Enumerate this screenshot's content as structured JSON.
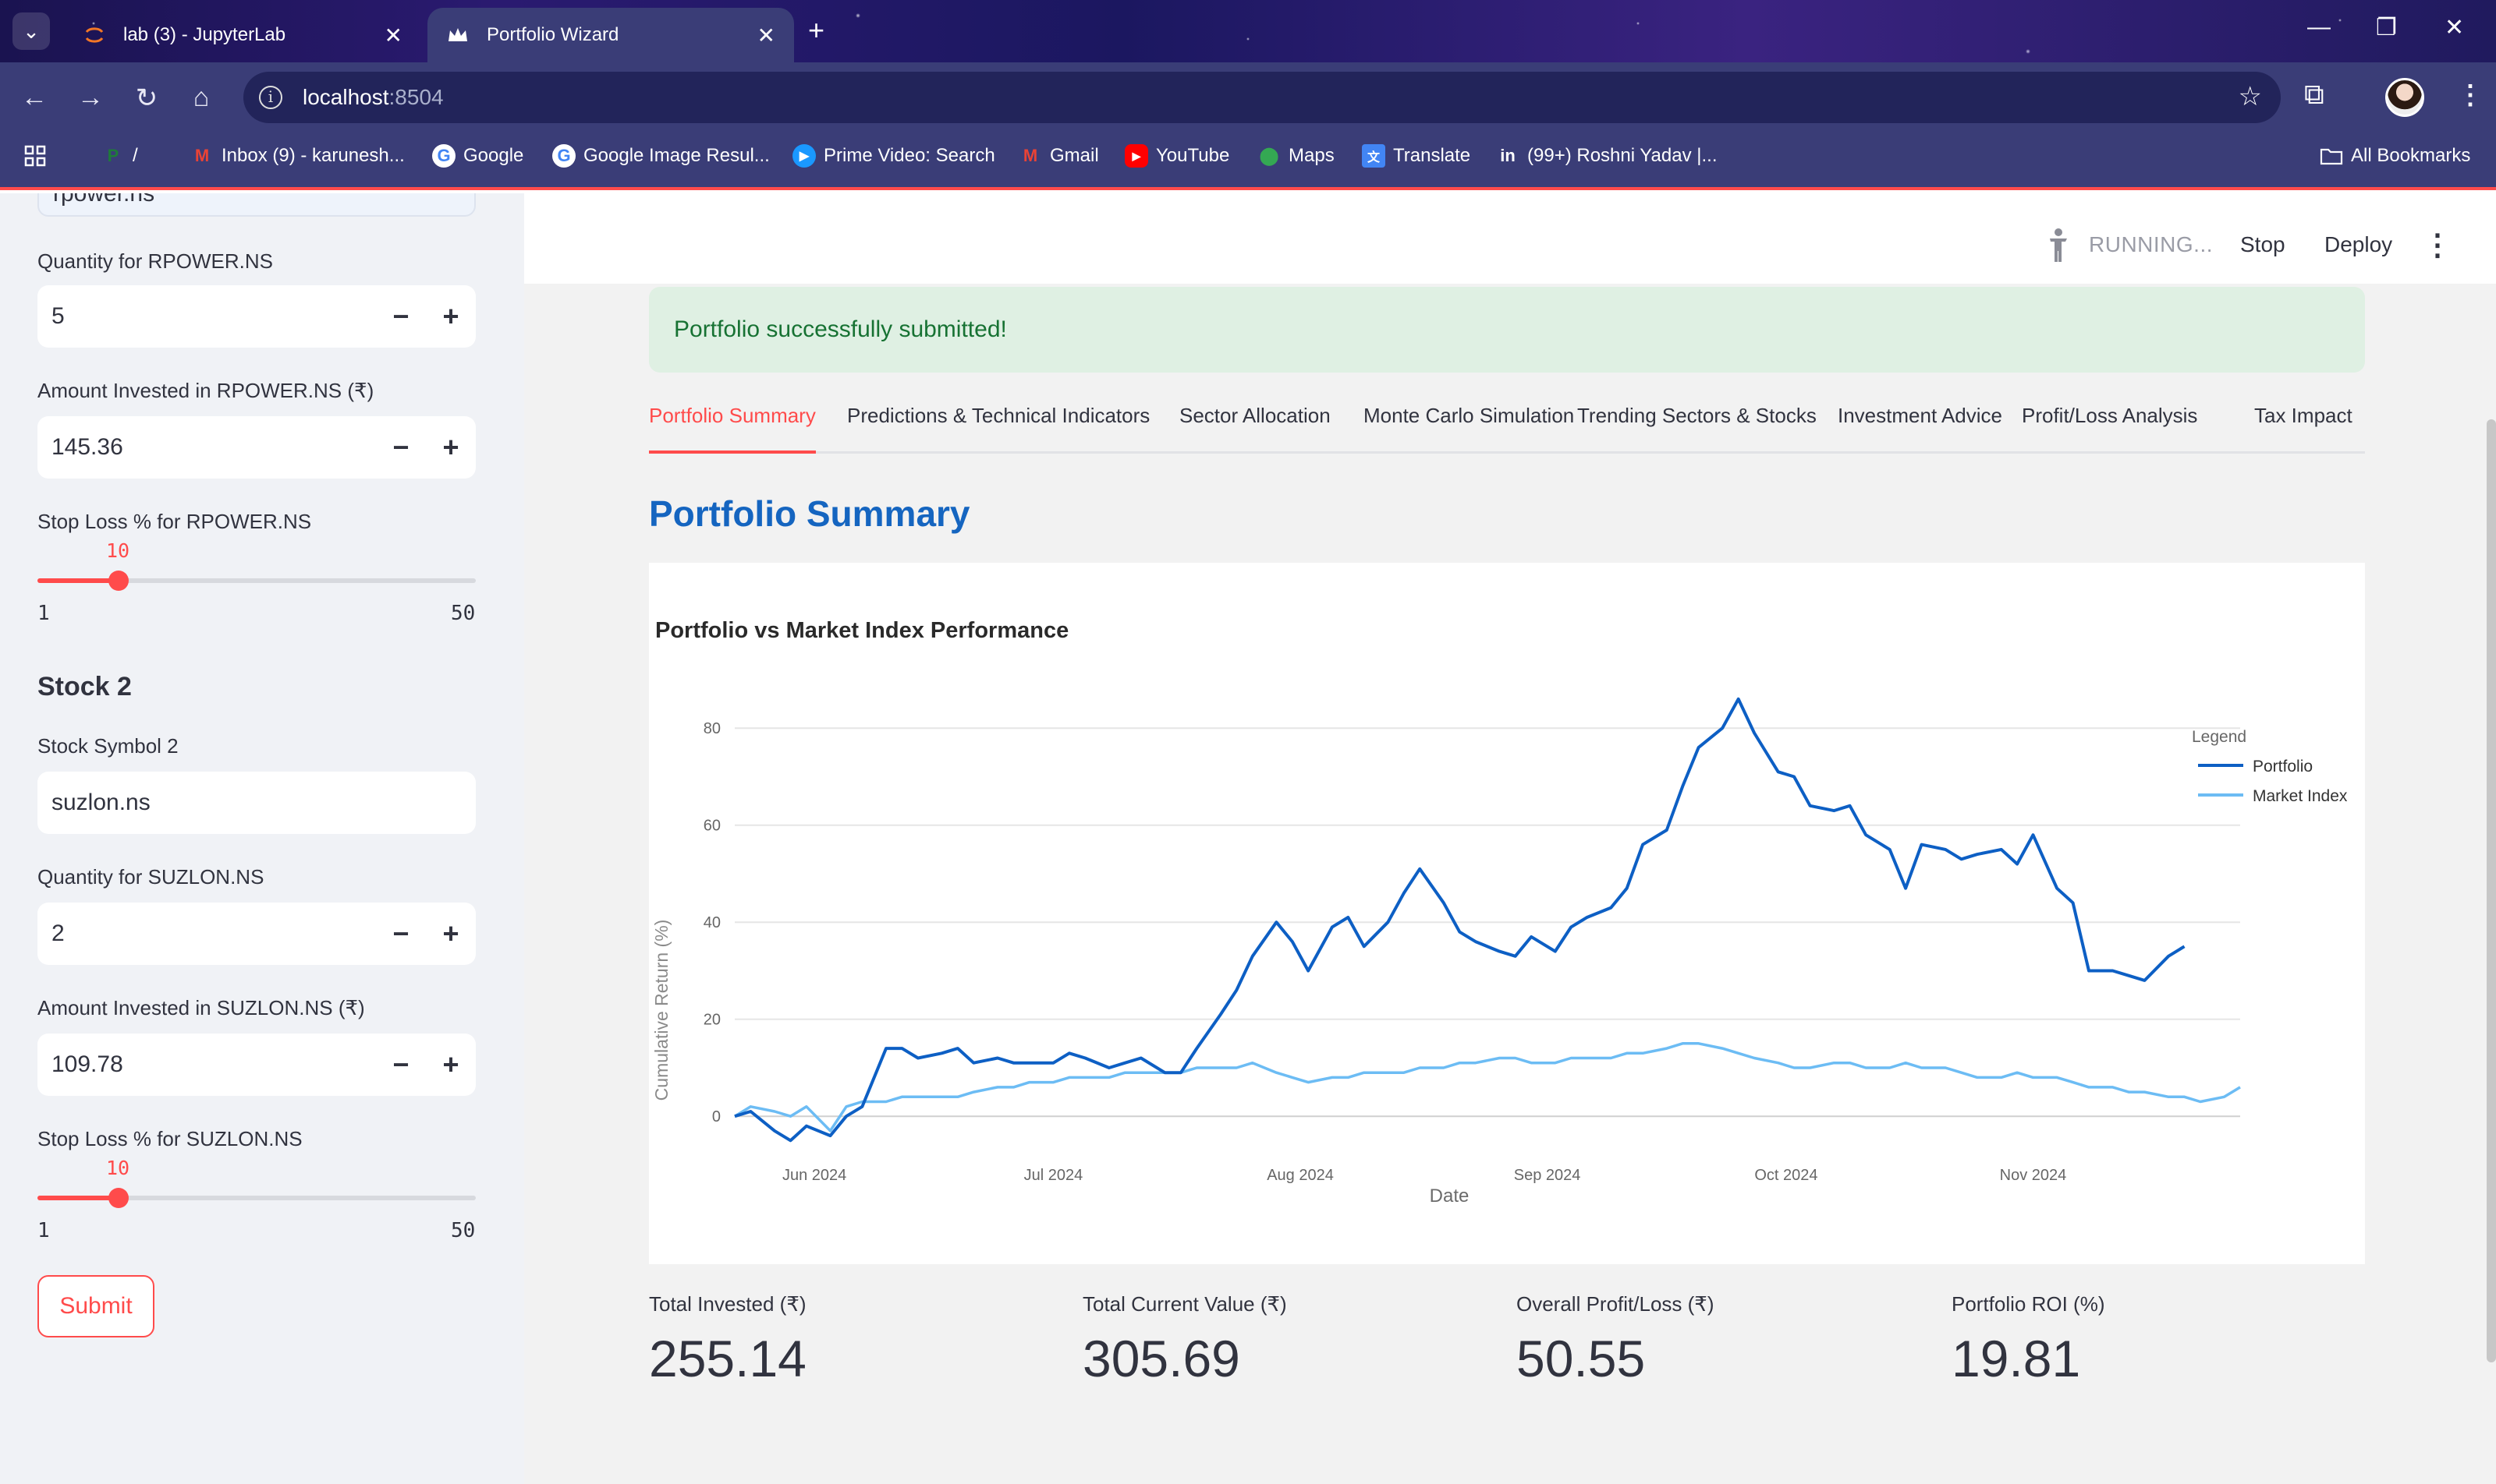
{
  "browser": {
    "tabs": [
      {
        "title": "lab (3) - JupyterLab",
        "active": false
      },
      {
        "title": "Portfolio Wizard",
        "active": true
      }
    ],
    "url_host": "localhost",
    "url_port": ":8504",
    "bookmarks": [
      {
        "label": "/",
        "icon": "separator-slash-icon"
      },
      {
        "label": "Inbox (9) - karunesh...",
        "icon": "gmail-icon"
      },
      {
        "label": "Google",
        "icon": "google-icon"
      },
      {
        "label": "Google Image Resul...",
        "icon": "google-icon"
      },
      {
        "label": "Prime Video: Search",
        "icon": "prime-video-icon"
      },
      {
        "label": "Gmail",
        "icon": "gmail-icon"
      },
      {
        "label": "YouTube",
        "icon": "youtube-icon"
      },
      {
        "label": "Maps",
        "icon": "maps-icon"
      },
      {
        "label": "Translate",
        "icon": "translate-icon"
      },
      {
        "label": "(99+) Roshni Yadav |...",
        "icon": "linkedin-icon"
      }
    ],
    "all_bookmarks": "All Bookmarks"
  },
  "sidebar": {
    "partial_value": "rpower.ns",
    "stock1": {
      "quantity_label": "Quantity for RPOWER.NS",
      "quantity_value": "5",
      "amount_label": "Amount Invested in RPOWER.NS (₹)",
      "amount_value": "145.36",
      "stoploss_label": "Stop Loss % for RPOWER.NS",
      "stoploss_value": "10",
      "stoploss_min": "1",
      "stoploss_max": "50"
    },
    "stock2": {
      "heading": "Stock 2",
      "symbol_label": "Stock Symbol 2",
      "symbol_value": "suzlon.ns",
      "quantity_label": "Quantity for SUZLON.NS",
      "quantity_value": "2",
      "amount_label": "Amount Invested in SUZLON.NS (₹)",
      "amount_value": "109.78",
      "stoploss_label": "Stop Loss % for SUZLON.NS",
      "stoploss_value": "10",
      "stoploss_min": "1",
      "stoploss_max": "50"
    },
    "submit_label": "Submit",
    "stepper_minus": "−",
    "stepper_plus": "+"
  },
  "header": {
    "status": "RUNNING...",
    "stop_label": "Stop",
    "deploy_label": "Deploy"
  },
  "main": {
    "success_message": "Portfolio successfully submitted!",
    "tabs": [
      {
        "label": "Portfolio Summary",
        "active": true
      },
      {
        "label": "Predictions & Technical Indicators"
      },
      {
        "label": "Sector Allocation"
      },
      {
        "label": "Monte Carlo Simulation"
      },
      {
        "label": "Trending Sectors & Stocks"
      },
      {
        "label": "Investment Advice"
      },
      {
        "label": "Profit/Loss Analysis"
      },
      {
        "label": "Tax Impact"
      }
    ],
    "section_title": "Portfolio Summary",
    "metrics": [
      {
        "label": "Total Invested (₹)",
        "value": "255.14"
      },
      {
        "label": "Total Current Value (₹)",
        "value": "305.69"
      },
      {
        "label": "Overall Profit/Loss (₹)",
        "value": "50.55"
      },
      {
        "label": "Portfolio ROI (%)",
        "value": "19.81"
      }
    ]
  },
  "chart_data": {
    "type": "line",
    "title": "Portfolio vs Market Index Performance",
    "xlabel": "Date",
    "ylabel": "Cumulative Return (%)",
    "x_tick_labels": [
      "Jun 2024",
      "Jul 2024",
      "Aug 2024",
      "Sep 2024",
      "Oct 2024",
      "Nov 2024"
    ],
    "y_ticks": [
      0,
      20,
      40,
      60,
      80
    ],
    "xlim": [
      "2024-05-22",
      "2024-11-27"
    ],
    "ylim": [
      -8,
      90
    ],
    "grid": true,
    "legend_title": "Legend",
    "legend_position": "top-right",
    "x": [
      "2024-05-22",
      "2024-05-24",
      "2024-05-27",
      "2024-05-29",
      "2024-05-31",
      "2024-06-03",
      "2024-06-05",
      "2024-06-07",
      "2024-06-10",
      "2024-06-12",
      "2024-06-14",
      "2024-06-17",
      "2024-06-19",
      "2024-06-21",
      "2024-06-24",
      "2024-06-26",
      "2024-06-28",
      "2024-07-01",
      "2024-07-03",
      "2024-07-05",
      "2024-07-08",
      "2024-07-10",
      "2024-07-12",
      "2024-07-15",
      "2024-07-17",
      "2024-07-19",
      "2024-07-22",
      "2024-07-24",
      "2024-07-26",
      "2024-07-29",
      "2024-07-31",
      "2024-08-02",
      "2024-08-05",
      "2024-08-07",
      "2024-08-09",
      "2024-08-12",
      "2024-08-14",
      "2024-08-16",
      "2024-08-19",
      "2024-08-21",
      "2024-08-23",
      "2024-08-26",
      "2024-08-28",
      "2024-08-30",
      "2024-09-02",
      "2024-09-04",
      "2024-09-06",
      "2024-09-09",
      "2024-09-11",
      "2024-09-13",
      "2024-09-16",
      "2024-09-18",
      "2024-09-20",
      "2024-09-23",
      "2024-09-25",
      "2024-09-27",
      "2024-09-30",
      "2024-10-02",
      "2024-10-04",
      "2024-10-07",
      "2024-10-09",
      "2024-10-11",
      "2024-10-14",
      "2024-10-16",
      "2024-10-18",
      "2024-10-21",
      "2024-10-23",
      "2024-10-25",
      "2024-10-28",
      "2024-10-30",
      "2024-11-01",
      "2024-11-04",
      "2024-11-06",
      "2024-11-08",
      "2024-11-11",
      "2024-11-13",
      "2024-11-15",
      "2024-11-18",
      "2024-11-20",
      "2024-11-22",
      "2024-11-25",
      "2024-11-27"
    ],
    "series": [
      {
        "name": "Portfolio",
        "color": "#0d5fc4",
        "values": [
          0,
          1,
          -3,
          -5,
          -2,
          -4,
          0,
          2,
          14,
          14,
          12,
          13,
          14,
          11,
          12,
          11,
          11,
          11,
          13,
          12,
          10,
          11,
          12,
          9,
          9,
          14,
          21,
          26,
          33,
          40,
          36,
          30,
          39,
          41,
          35,
          40,
          46,
          51,
          44,
          38,
          36,
          34,
          33,
          37,
          34,
          39,
          41,
          43,
          47,
          56,
          59,
          68,
          76,
          80,
          86,
          79,
          71,
          70,
          64,
          63,
          64,
          58,
          55,
          47,
          56,
          55,
          53,
          54,
          55,
          52,
          58,
          47,
          44,
          30,
          30,
          29,
          28,
          33,
          35
        ],
        "note_points_shown": 79
      },
      {
        "name": "Market Index",
        "color": "#6cbcf4",
        "values": [
          0,
          2,
          1,
          0,
          2,
          -3,
          2,
          3,
          3,
          4,
          4,
          4,
          4,
          5,
          6,
          6,
          7,
          7,
          8,
          8,
          8,
          9,
          9,
          9,
          9,
          10,
          10,
          10,
          11,
          9,
          8,
          7,
          8,
          8,
          9,
          9,
          9,
          10,
          10,
          11,
          11,
          12,
          12,
          11,
          11,
          12,
          12,
          12,
          13,
          13,
          14,
          15,
          15,
          14,
          13,
          12,
          11,
          10,
          10,
          11,
          11,
          10,
          10,
          11,
          10,
          10,
          9,
          8,
          8,
          9,
          8,
          8,
          7,
          6,
          6,
          5,
          5,
          4,
          4,
          3,
          4,
          6
        ]
      }
    ]
  }
}
